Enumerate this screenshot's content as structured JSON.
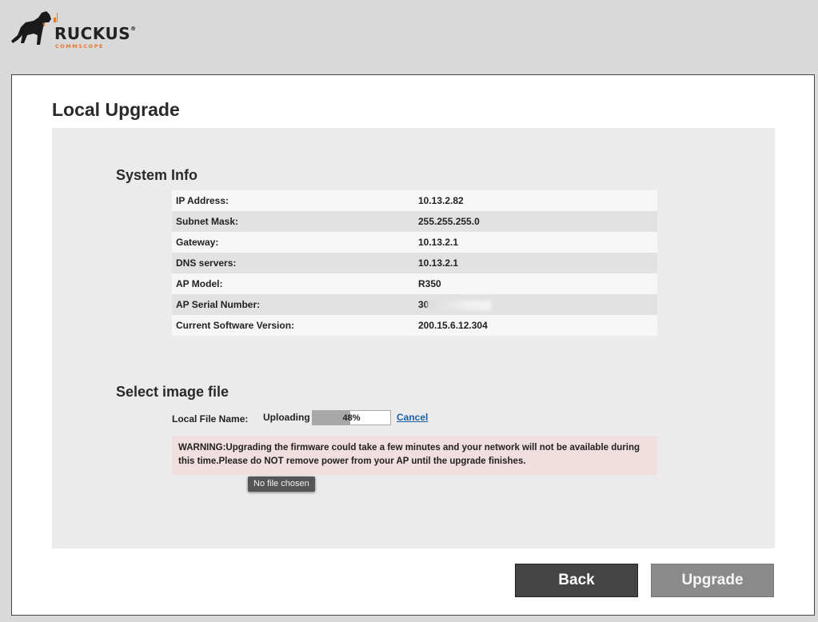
{
  "brand": {
    "name": "RUCKUS",
    "sub": "COMMSCOPE",
    "accent_color": "#e8772e",
    "icon": "dog-logo-icon"
  },
  "page": {
    "title": "Local Upgrade"
  },
  "system_info": {
    "title": "System Info",
    "rows": [
      {
        "label": "IP Address:",
        "value": "10.13.2.82"
      },
      {
        "label": "Subnet Mask:",
        "value": "255.255.255.0"
      },
      {
        "label": "Gateway:",
        "value": "10.13.2.1"
      },
      {
        "label": "DNS servers:",
        "value": "10.13.2.1"
      },
      {
        "label": "AP Model:",
        "value": "R350"
      },
      {
        "label": "AP Serial Number:",
        "value": "30"
      },
      {
        "label": "Current Software Version:",
        "value": "200.15.6.12.304"
      }
    ]
  },
  "image_file": {
    "title": "Select image file",
    "file_label": "Local File Name:",
    "status": "Uploading",
    "progress_percent": 48,
    "progress_text": "48%",
    "cancel_label": "Cancel",
    "warning": "WARNING:Upgrading the firmware could take a few minutes and your network will not be available during this time.Please do NOT remove power from your AP until the upgrade finishes.",
    "tooltip": "No file chosen"
  },
  "buttons": {
    "back": "Back",
    "upgrade": "Upgrade"
  }
}
